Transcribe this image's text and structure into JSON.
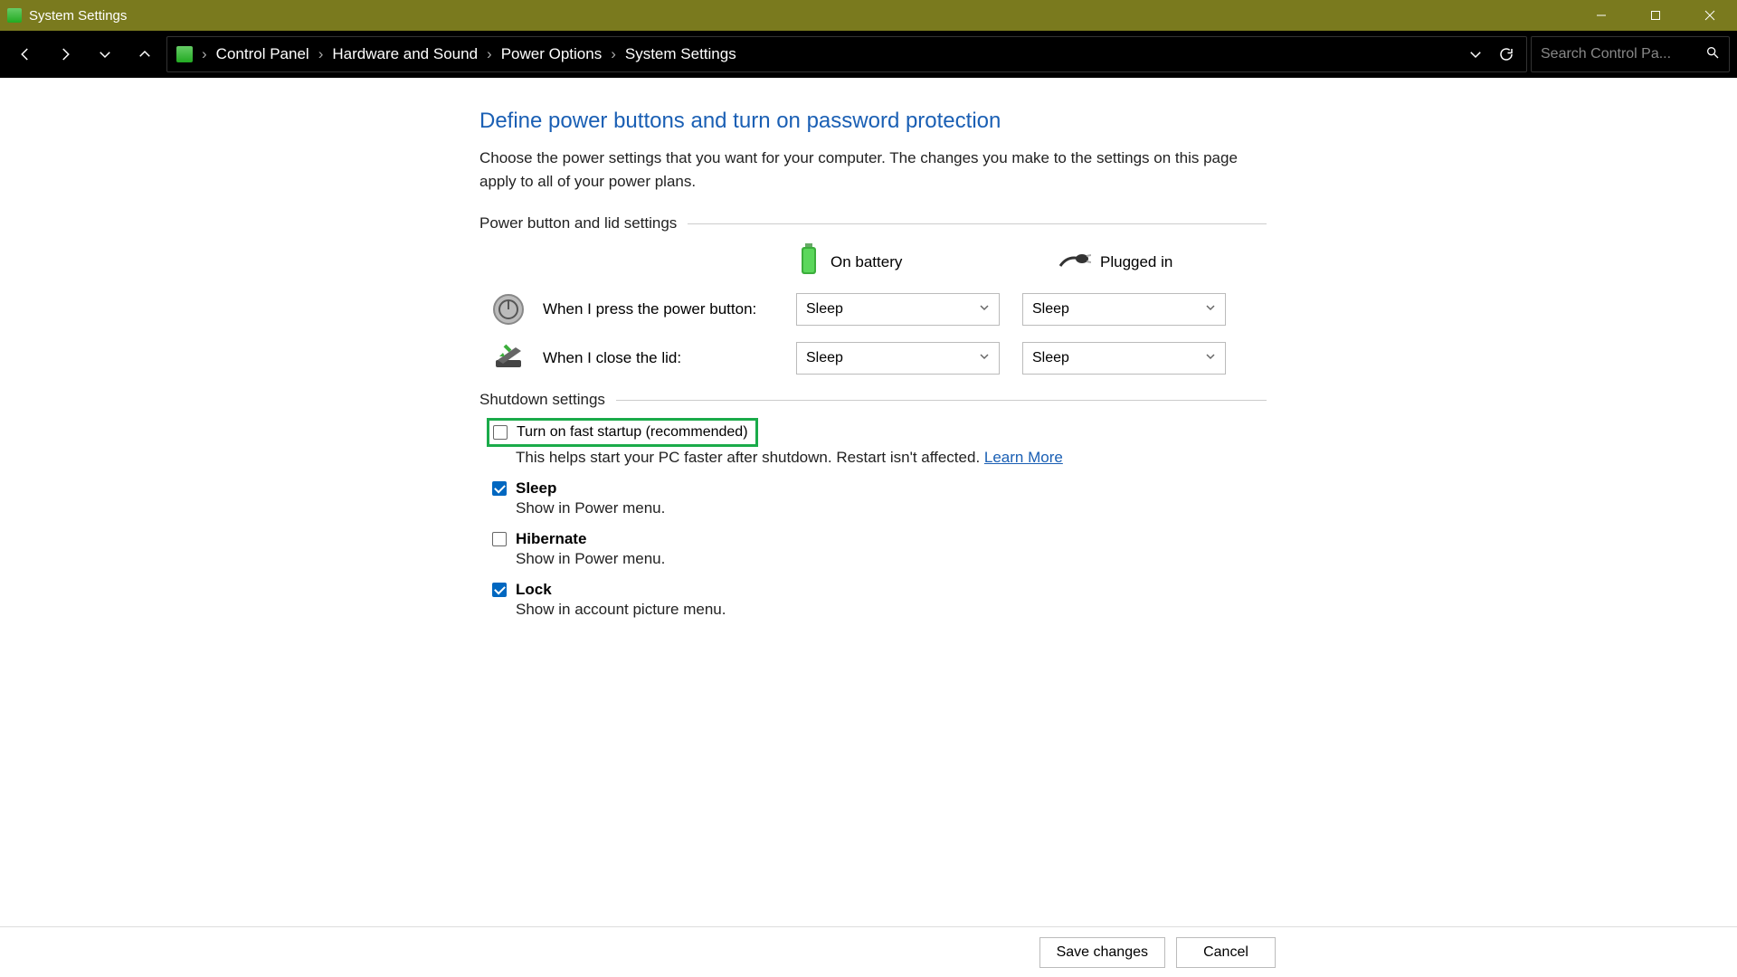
{
  "window": {
    "title": "System Settings"
  },
  "breadcrumbs": [
    "Control Panel",
    "Hardware and Sound",
    "Power Options",
    "System Settings"
  ],
  "search": {
    "placeholder": "Search Control Pa..."
  },
  "page": {
    "title": "Define power buttons and turn on password protection",
    "desc": "Choose the power settings that you want for your computer. The changes you make to the settings on this page apply to all of your power plans."
  },
  "section1": "Power button and lid settings",
  "columns": {
    "battery": "On battery",
    "plugged": "Plugged in"
  },
  "rows": {
    "power_button": {
      "label": "When I press the power button:",
      "battery": "Sleep",
      "plugged": "Sleep"
    },
    "close_lid": {
      "label": "When I close the lid:",
      "battery": "Sleep",
      "plugged": "Sleep"
    }
  },
  "section2": "Shutdown settings",
  "shutdown": {
    "fast_startup": {
      "label": "Turn on fast startup (recommended)",
      "desc": "This helps start your PC faster after shutdown. Restart isn't affected. ",
      "learn": "Learn More",
      "checked": false
    },
    "sleep": {
      "label": "Sleep",
      "desc": "Show in Power menu.",
      "checked": true
    },
    "hibernate": {
      "label": "Hibernate",
      "desc": "Show in Power menu.",
      "checked": false
    },
    "lock": {
      "label": "Lock",
      "desc": "Show in account picture menu.",
      "checked": true
    }
  },
  "buttons": {
    "save": "Save changes",
    "cancel": "Cancel"
  }
}
